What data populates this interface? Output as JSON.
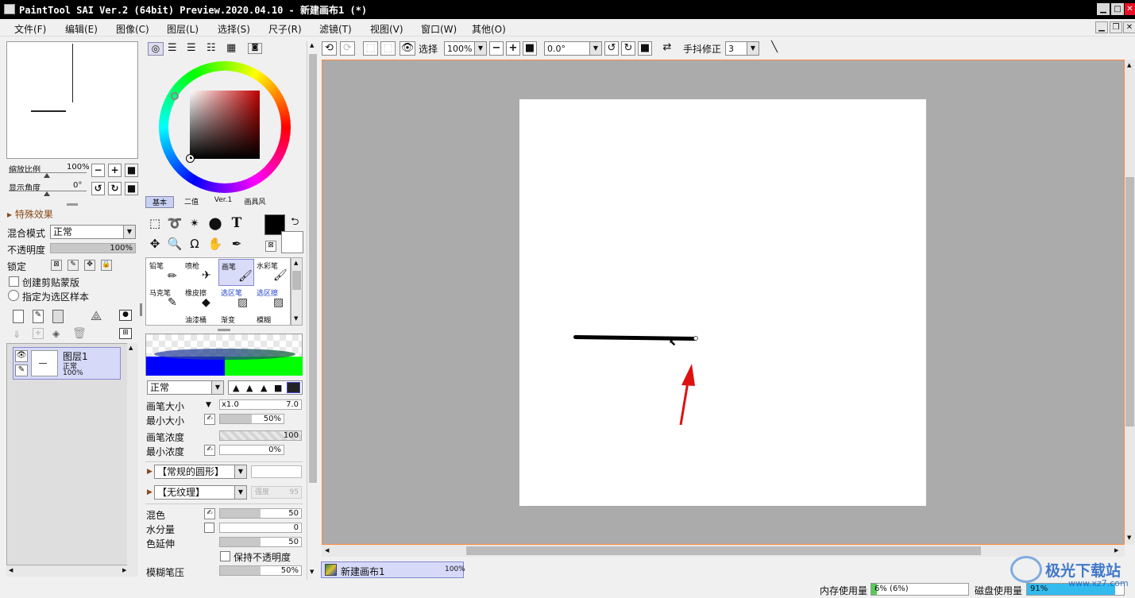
{
  "window": {
    "title": "PaintTool SAI Ver.2 (64bit) Preview.2020.04.10 - 新建画布1 (*)"
  },
  "menu": [
    "文件(F)",
    "编辑(E)",
    "图像(C)",
    "图层(L)",
    "选择(S)",
    "尺子(R)",
    "滤镜(T)",
    "视图(V)",
    "窗口(W)",
    "其他(O)"
  ],
  "navigator": {
    "zoom_label": "缩放比例",
    "zoom_value": "100%",
    "angle_label": "显示角度",
    "angle_value": "0°"
  },
  "layer_panel": {
    "effects_label": "特殊效果",
    "blend_label": "混合模式",
    "blend_value": "正常",
    "opacity_label": "不透明度",
    "opacity_value": "100%",
    "lock_label": "锁定",
    "clip_label": "创建剪贴蒙版",
    "sample_label": "指定为选区样本",
    "layer_name": "图层1",
    "layer_mode": "正常",
    "layer_opacity": "100%"
  },
  "color_tabs": [
    "基本",
    "二值",
    "Ver.1",
    "画具风"
  ],
  "brushes": [
    "铅笔",
    "喷枪",
    "画笔",
    "水彩笔",
    "马克笔",
    "橡皮擦",
    "选区笔",
    "选区擦",
    "",
    "油漆桶",
    "渐变",
    "模糊"
  ],
  "brush_settings": {
    "mode": "正常",
    "size_label": "画笔大小",
    "size_mult": "x1.0",
    "size_value": "7.0",
    "min_size_label": "最小大小",
    "min_size_value": "50%",
    "density_label": "画笔浓度",
    "density_value": "100",
    "min_density_label": "最小浓度",
    "min_density_value": "0%",
    "shape": "【常规的圆形】",
    "texture": "【无纹理】",
    "texture_strength": "强度",
    "texture_strength_value": "95",
    "blend_label": "混色",
    "blend_value": "50",
    "water_label": "水分量",
    "water_value": "0",
    "color_stretch_label": "色延伸",
    "color_stretch_value": "50",
    "keep_opacity_label": "保持不透明度",
    "blur_label": "模糊笔压",
    "blur_value": "50%"
  },
  "toolbar": {
    "select_label": "选择",
    "zoom_value": "100%",
    "angle_value": "0.0°",
    "stabilizer_label": "手抖修正",
    "stabilizer_value": "3"
  },
  "canvas_tab": {
    "name": "新建画布1",
    "zoom": "100%"
  },
  "status": {
    "mem_label": "内存使用量",
    "mem_value": "6% (6%)",
    "mem_fraction": 0.06,
    "disk_label": "磁盘使用量",
    "disk_value": "91%",
    "disk_fraction": 0.91
  },
  "watermark": {
    "text": "极光下载站",
    "url": "www.xz7.com"
  },
  "colors": {
    "current": "#000000",
    "secondary": "#ffffff",
    "hue_box": "#c00000",
    "gradient_left": "#0000ff",
    "gradient_right": "#00ff00",
    "annotation": "#dd1111"
  }
}
